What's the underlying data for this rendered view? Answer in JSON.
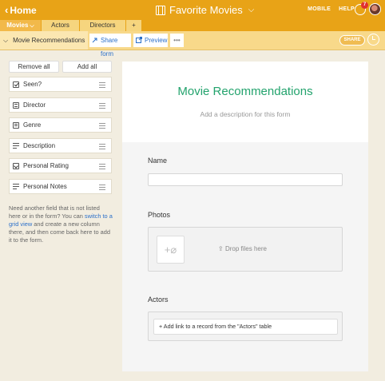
{
  "header": {
    "home_label": "Home",
    "base_title": "Favorite Movies",
    "menu": [
      "MOBILE",
      "HELP"
    ],
    "notification_count": "7"
  },
  "tabs": [
    {
      "label": "Movies",
      "active": true
    },
    {
      "label": "Actors",
      "active": false
    },
    {
      "label": "Directors",
      "active": false
    },
    {
      "label": "+",
      "active": false
    }
  ],
  "viewbar": {
    "view_name": "Movie Recommendations",
    "share_form_label": "Share form",
    "preview_label": "Preview",
    "more_label": "•••",
    "share_label": "SHARE"
  },
  "sidebar": {
    "remove_all_label": "Remove all",
    "add_all_label": "Add all",
    "fields": [
      {
        "label": "Seen?",
        "icon": "checkbox-icon"
      },
      {
        "label": "Director",
        "icon": "linked-record-icon"
      },
      {
        "label": "Genre",
        "icon": "multiselect-icon"
      },
      {
        "label": "Description",
        "icon": "long-text-icon"
      },
      {
        "label": "Personal Rating",
        "icon": "single-select-icon"
      },
      {
        "label": "Personal Notes",
        "icon": "long-text-icon"
      }
    ],
    "help_pre": "Need another field that is not listed here or in the form? You can ",
    "help_link": "switch to a grid view",
    "help_post": " and create a new column there, and then come back here to add it to the form."
  },
  "form": {
    "title": "Movie Recommendations",
    "description_placeholder": "Add a description for this form",
    "fields": {
      "name_label": "Name",
      "photos_label": "Photos",
      "drop_text": "Drop files here",
      "actors_label": "Actors",
      "add_link_text": "+ Add link to a record from the \"Actors\" table"
    }
  },
  "colors": {
    "topbar": "#e8a317",
    "accent_green": "#23a36d",
    "link_blue": "#2a6fc9"
  }
}
